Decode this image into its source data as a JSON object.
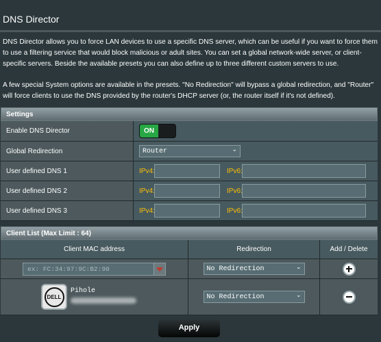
{
  "page": {
    "title": "DNS Director",
    "description_1": "DNS Director allows you to force LAN devices to use a specific DNS server, which can be useful if you want to force them to use a filtering service that would block malicious or adult sites. You can set a global network-wide server, or client-specific servers. Beside the available presets you can also define up to three different custom servers to use.",
    "description_2": "A few special System options are available in the presets. \"No Redirection\" will bypass a global redirection, and \"Router\" will force clients to use the DNS provided by the router's DHCP server (or, the router itself if it's not defined)."
  },
  "settings": {
    "heading": "Settings",
    "enable_label": "Enable DNS Director",
    "enable_state": "ON",
    "global_label": "Global Redirection",
    "global_value": "Router",
    "dns1_label": "User defined DNS 1",
    "dns2_label": "User defined DNS 2",
    "dns3_label": "User defined DNS 3",
    "ipv4_label": "IPv4:",
    "ipv6_label": "IPv6:"
  },
  "clients": {
    "heading": "Client List (Max Limit : 64)",
    "col_mac": "Client MAC address",
    "col_redirection": "Redirection",
    "col_add_delete": "Add / Delete",
    "new_mac_placeholder": "ex: FC:34:97:9C:B2:90",
    "new_redirection": "No Redirection",
    "entries": [
      {
        "name": "Pihole",
        "brand_logo": "DELL",
        "redirection": "No Redirection"
      }
    ]
  },
  "apply_label": "Apply",
  "icons": {
    "toggle": "toggle-switch",
    "dropdown": "chevron-down-icon",
    "add": "plus-circle-icon",
    "delete": "minus-circle-icon",
    "device": "dell-logo-icon"
  },
  "colors": {
    "background": "#2b373b",
    "accent_on": "#28a745",
    "ip_label": "#ffc107"
  }
}
